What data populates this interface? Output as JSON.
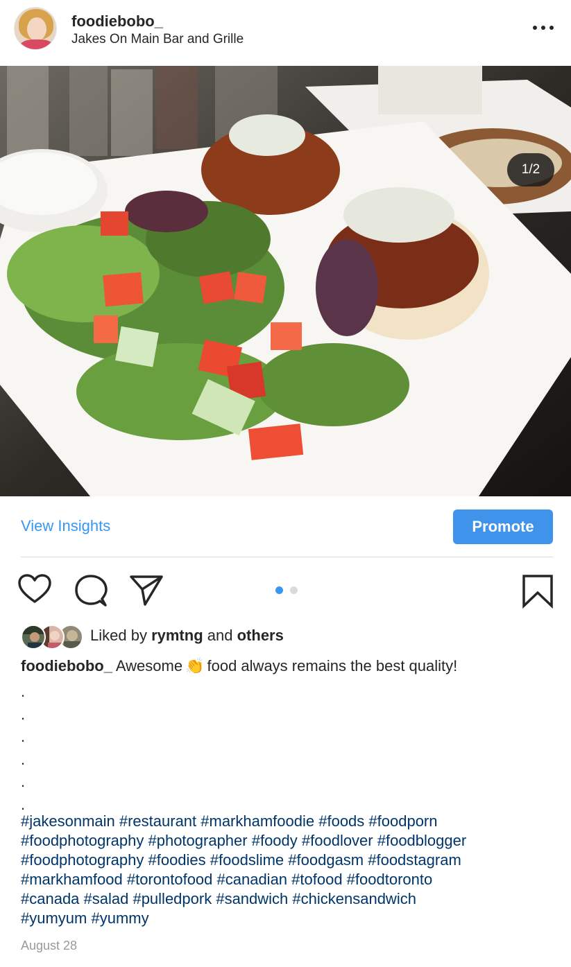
{
  "header": {
    "username": "foodiebobo_",
    "location": "Jakes On Main Bar and Grille",
    "more_icon": "more-horizontal-icon"
  },
  "photo": {
    "counter": "1/2",
    "tag_icon": "person-icon"
  },
  "insights": {
    "view_insights_label": "View Insights",
    "promote_label": "Promote"
  },
  "actions": {
    "like_icon": "heart-icon",
    "comment_icon": "comment-icon",
    "share_icon": "paper-plane-icon",
    "save_icon": "bookmark-icon",
    "carousel_current": 1,
    "carousel_total": 2
  },
  "likes": {
    "prefix": "Liked by",
    "user": "rymtng",
    "middle": "and",
    "suffix": "others"
  },
  "caption": {
    "username": "foodiebobo_",
    "text_before": "Awesome",
    "emoji": "👏",
    "text_after": "food always remains the best quality!",
    "dots": [
      ".",
      ".",
      ".",
      ".",
      ".",
      "."
    ],
    "hashtag_lines": [
      "#jakesonmain #restaurant #markhamfoodie #foods #foodporn",
      "#foodphotography #photographer #foody #foodlover #foodblogger",
      "#foodphotography #foodies #foodslime #foodgasm #foodstagram",
      "#markhamfood #torontofood #canadian #tofood #foodtoronto",
      "#canada #salad #pulledpork #sandwich #chickensandwich",
      "#yumyum #yummy"
    ]
  },
  "date": "August 28",
  "colors": {
    "link_blue": "#3897f0",
    "promote_blue": "#3f93eb",
    "hashtag_blue": "#003569",
    "date_gray": "#999999",
    "dot_active": "#3897f0",
    "dot_inactive": "#dbdbdb"
  }
}
